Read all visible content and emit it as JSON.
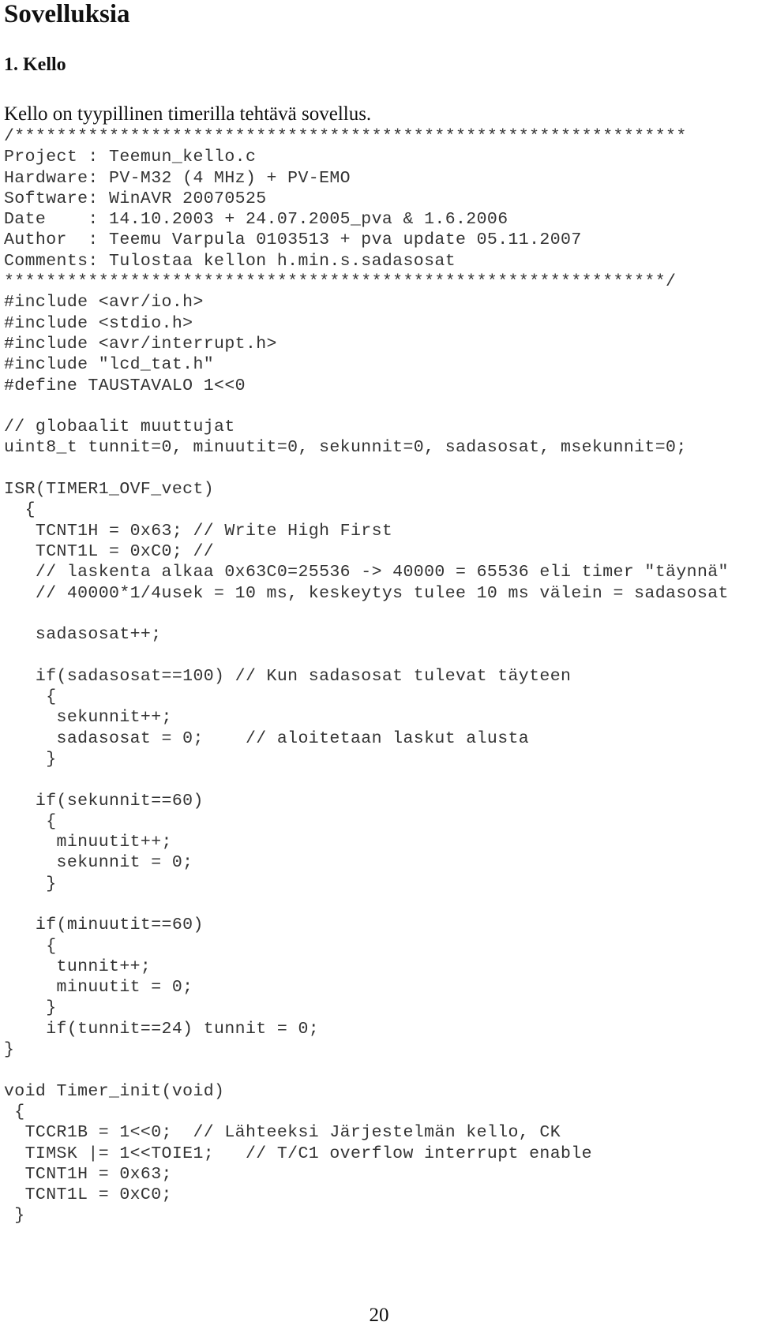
{
  "document": {
    "title": "Sovelluksia",
    "section_heading": "1. Kello",
    "intro": "Kello on tyypillinen timerilla tehtävä sovellus.",
    "code_lines": [
      "/****************************************************************",
      "Project : Teemun_kello.c",
      "Hardware: PV-M32 (4 MHz) + PV-EMO",
      "Software: WinAVR 20070525",
      "Date    : 14.10.2003 + 24.07.2005_pva & 1.6.2006",
      "Author  : Teemu Varpula 0103513 + pva update 05.11.2007",
      "Comments: Tulostaa kellon h.min.s.sadasosat",
      "***************************************************************/",
      "#include <avr/io.h>",
      "#include <stdio.h>",
      "#include <avr/interrupt.h>",
      "#include \"lcd_tat.h\"",
      "#define TAUSTAVALO 1<<0",
      "",
      "// globaalit muuttujat",
      "uint8_t tunnit=0, minuutit=0, sekunnit=0, sadasosat, msekunnit=0;",
      "",
      "ISR(TIMER1_OVF_vect)",
      "  {",
      "   TCNT1H = 0x63; // Write High First",
      "   TCNT1L = 0xC0; //",
      "   // laskenta alkaa 0x63C0=25536 -> 40000 = 65536 eli timer \"täynnä\"",
      "   // 40000*1/4usek = 10 ms, keskeytys tulee 10 ms välein = sadasosat",
      "",
      "   sadasosat++;",
      "",
      "   if(sadasosat==100) // Kun sadasosat tulevat täyteen",
      "    {",
      "     sekunnit++;",
      "     sadasosat = 0;    // aloitetaan laskut alusta",
      "    }",
      "",
      "   if(sekunnit==60)",
      "    {",
      "     minuutit++;",
      "     sekunnit = 0;",
      "    }",
      "",
      "   if(minuutit==60)",
      "    {",
      "     tunnit++;",
      "     minuutit = 0;",
      "    }",
      "    if(tunnit==24) tunnit = 0;",
      "}",
      "",
      "void Timer_init(void)",
      " {",
      "  TCCR1B = 1<<0;  // Lähteeksi Järjestelmän kello, CK",
      "  TIMSK |= 1<<TOIE1;   // T/C1 overflow interrupt enable",
      "  TCNT1H = 0x63;",
      "  TCNT1L = 0xC0;",
      " }"
    ],
    "page_number": "20"
  }
}
